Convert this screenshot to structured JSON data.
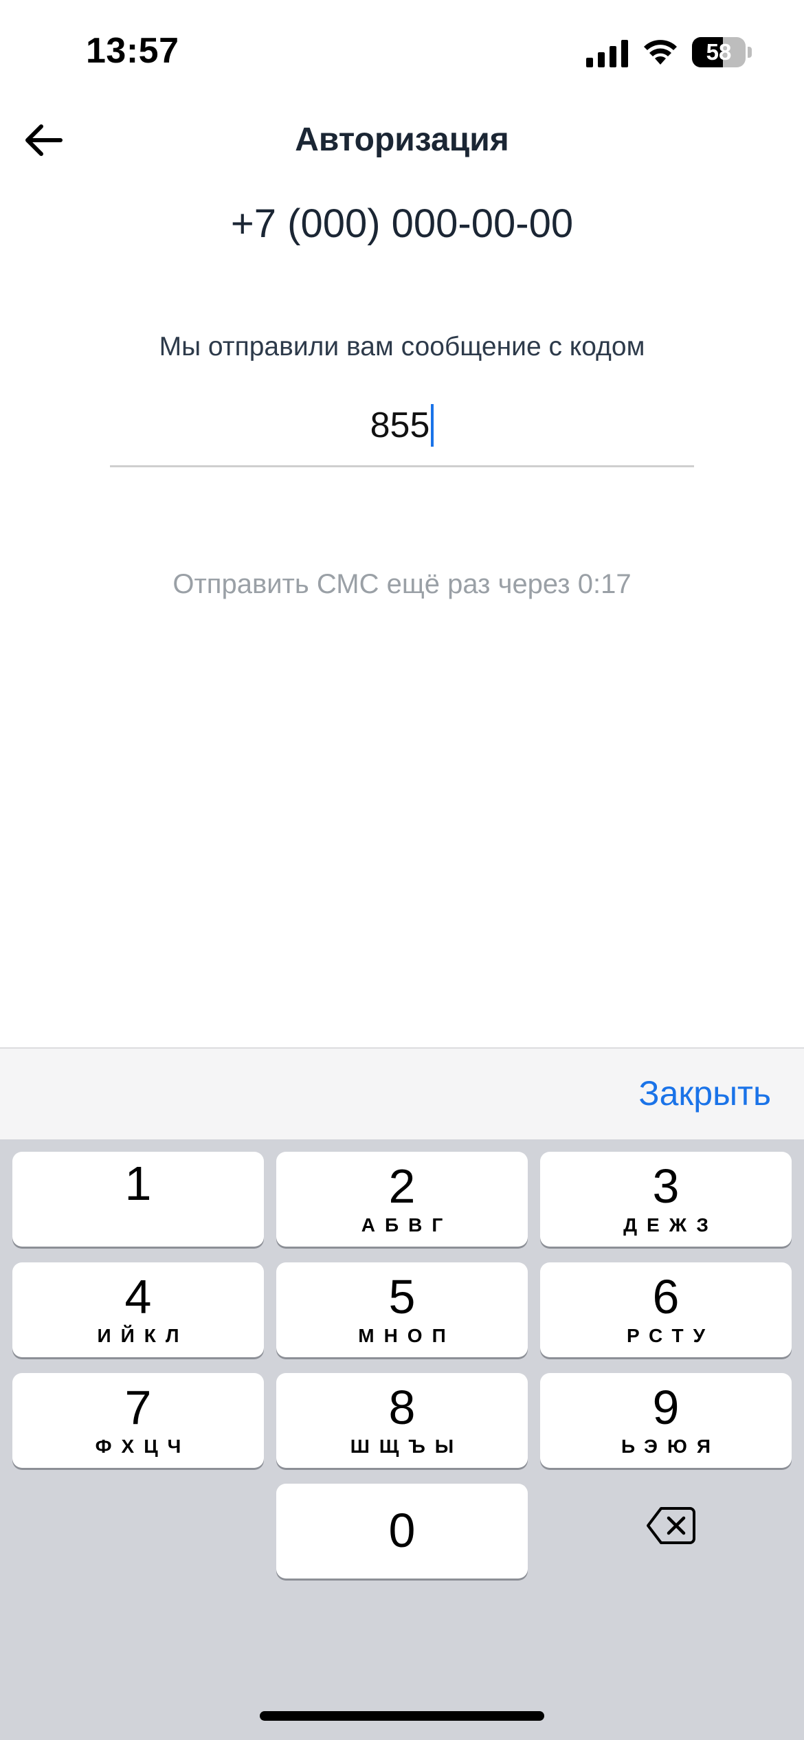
{
  "status_bar": {
    "time": "13:57",
    "battery_percent": "58",
    "battery_level": 0.58,
    "icons": [
      "cellular-signal-icon",
      "wifi-icon",
      "battery-icon"
    ]
  },
  "header": {
    "back_icon": "arrow-left-icon",
    "title": "Авторизация"
  },
  "auth": {
    "phone": "+7 (000) 000-00-00",
    "message": "Мы отправили вам сообщение с кодом",
    "code_value": "855",
    "resend_text": "Отправить СМС ещё раз через 0:17"
  },
  "keyboard": {
    "close_label": "Закрыть",
    "keys": [
      {
        "digit": "1",
        "letters": ""
      },
      {
        "digit": "2",
        "letters": "АБВГ"
      },
      {
        "digit": "3",
        "letters": "ДЕЖЗ"
      },
      {
        "digit": "4",
        "letters": "ИЙКЛ"
      },
      {
        "digit": "5",
        "letters": "МНОП"
      },
      {
        "digit": "6",
        "letters": "РСТУ"
      },
      {
        "digit": "7",
        "letters": "ФХЦЧ"
      },
      {
        "digit": "8",
        "letters": "ШЩЪЫ"
      },
      {
        "digit": "9",
        "letters": "ЬЭЮЯ"
      },
      {
        "digit": "0",
        "letters": ""
      }
    ],
    "delete_icon": "backspace-icon"
  },
  "colors": {
    "accent": "#1a73e8",
    "title_text": "#1b2634",
    "muted_text": "#9aa0a6",
    "keyboard_bg": "#d1d3d9"
  }
}
